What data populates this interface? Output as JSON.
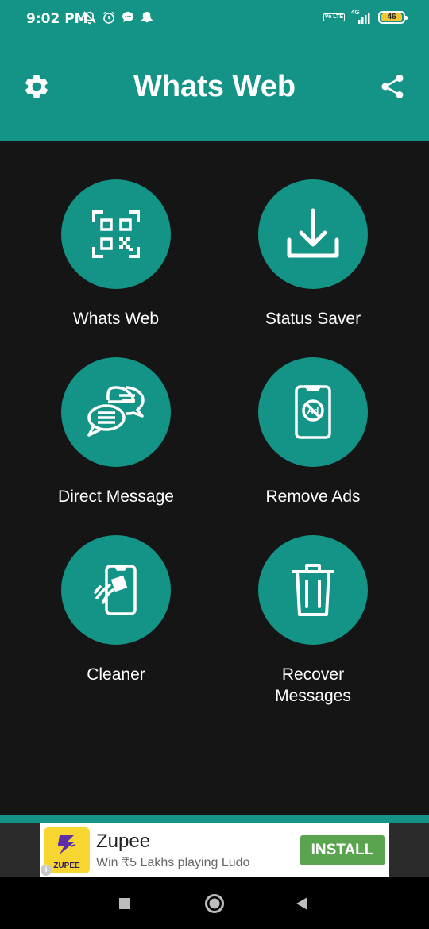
{
  "status_bar": {
    "time": "9:02 PM",
    "network": "4G",
    "volte": "Vo LTE",
    "battery": "46"
  },
  "app_bar": {
    "title": "Whats Web"
  },
  "tiles": [
    {
      "label": "Whats Web",
      "icon": "qr-scan-icon"
    },
    {
      "label": "Status Saver",
      "icon": "download-icon"
    },
    {
      "label": "Direct Message",
      "icon": "chat-bubbles-icon"
    },
    {
      "label": "Remove Ads",
      "icon": "phone-no-ads-icon"
    },
    {
      "label": "Cleaner",
      "icon": "phone-clean-icon"
    },
    {
      "label": "Recover Messages",
      "icon": "trash-icon"
    }
  ],
  "ad": {
    "brand": "Zupee",
    "logo_text": "ZUPEE",
    "tagline": "Win ₹5 Lakhs playing Ludo",
    "cta": "INSTALL",
    "info_mark": "i"
  },
  "colors": {
    "primary": "#139486",
    "background": "#151515",
    "install_green": "#5aa34f",
    "battery_yellow": "#f3c63a"
  }
}
